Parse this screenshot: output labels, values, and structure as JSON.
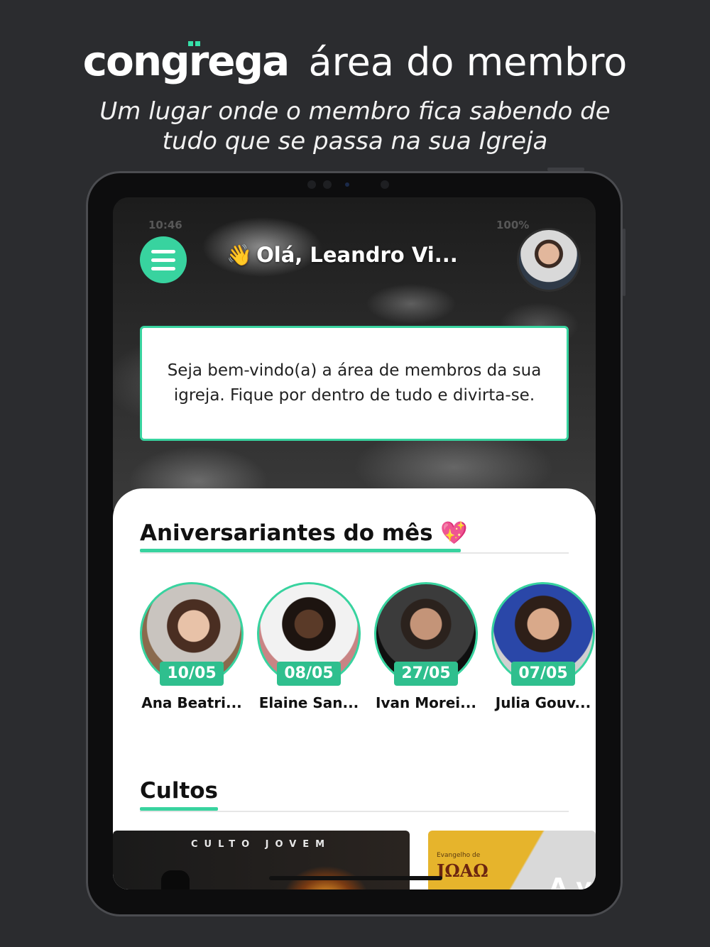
{
  "header": {
    "brand": "congrega",
    "tagline": "área do membro",
    "subtitle_line1": "Um lugar onde o membro fica sabendo de",
    "subtitle_line2": "tudo que se passa na sua Igreja"
  },
  "app": {
    "status_time": "10:46",
    "status_right": "100%",
    "greeting_emoji": "👋",
    "greeting": "Olá, Leandro Vi...",
    "welcome_text": "Seja bem-vindo(a) a área de membros da sua igreja. Fique por dentro de tudo e divirta-se.",
    "birthdays": {
      "title": "Aniversariantes do mês 💖",
      "people": [
        {
          "date": "10/05",
          "name": "Ana Beatri..."
        },
        {
          "date": "08/05",
          "name": "Elaine San..."
        },
        {
          "date": "27/05",
          "name": "Ivan Morei..."
        },
        {
          "date": "07/05",
          "name": "Julia Gouv..."
        }
      ]
    },
    "cultos": {
      "title": "Cultos",
      "cards": [
        {
          "label": "CULTO JOVEM"
        },
        {
          "label": "JΩAΩ",
          "caption": "Evangelho de",
          "overlay": "A v"
        }
      ]
    }
  },
  "colors": {
    "accent": "#38d39f",
    "background": "#2b2c2f"
  }
}
